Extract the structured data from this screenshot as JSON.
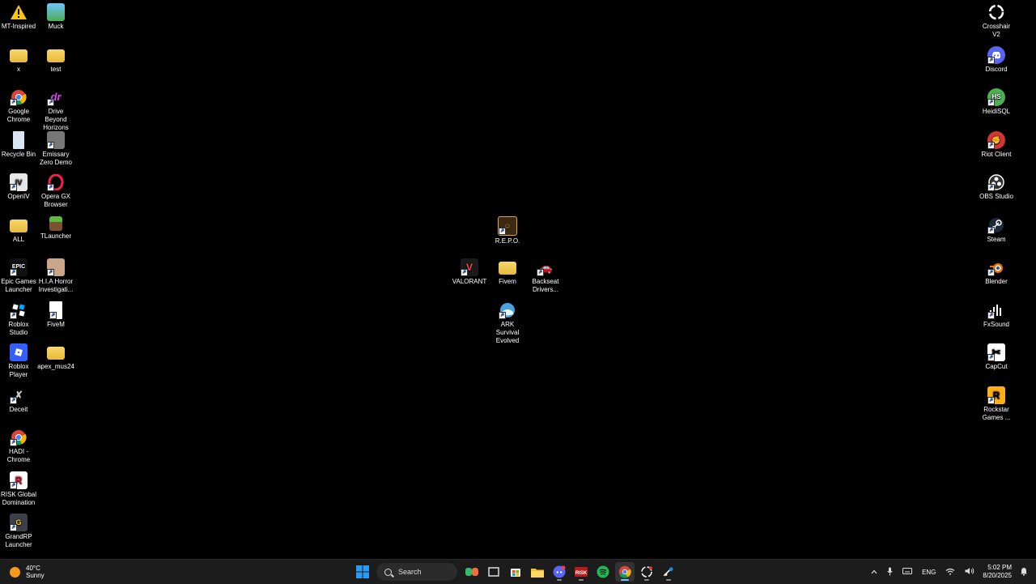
{
  "desktop_icons": [
    {
      "label": "MT-Inspired",
      "icon": "warning-icon"
    },
    {
      "label": "Muck",
      "icon": "muck-icon"
    },
    {
      "label": "x",
      "icon": "folder-icon"
    },
    {
      "label": "test",
      "icon": "folder-icon"
    },
    {
      "label": "Google Chrome",
      "icon": "chrome-icon"
    },
    {
      "label": "Drive Beyond Horizons D...",
      "icon": "drive-beyond-horizons-icon"
    },
    {
      "label": "Recycle Bin",
      "icon": "recycle-bin-icon"
    },
    {
      "label": "Emissary Zero Demo",
      "icon": "emissary-zero-icon"
    },
    {
      "label": "OpenIV",
      "icon": "openiv-icon"
    },
    {
      "label": "Opera GX Browser",
      "icon": "opera-gx-icon"
    },
    {
      "label": "ALL",
      "icon": "folder-icon"
    },
    {
      "label": "TLauncher",
      "icon": "tlauncher-icon"
    },
    {
      "label": "Epic Games Launcher",
      "icon": "epic-games-icon"
    },
    {
      "label": "H.I.A Horror Investigati...",
      "icon": "hia-horror-icon"
    },
    {
      "label": "Roblox Studio",
      "icon": "roblox-studio-icon"
    },
    {
      "label": "FiveM",
      "icon": "document-icon"
    },
    {
      "label": "Roblox Player",
      "icon": "roblox-player-icon"
    },
    {
      "label": "apex_mus24",
      "icon": "folder-icon"
    },
    {
      "label": "Deceit",
      "icon": "deceit-icon"
    },
    {
      "label": "HADI - Chrome",
      "icon": "chrome-icon"
    },
    {
      "label": "RISK Global Domination",
      "icon": "risk-icon"
    },
    {
      "label": "GrandRP Launcher",
      "icon": "grandrp-icon"
    },
    {
      "label": "R.E.P.O.",
      "icon": "repo-icon"
    },
    {
      "label": "VALORANT",
      "icon": "valorant-icon"
    },
    {
      "label": "Fivem",
      "icon": "folder-icon"
    },
    {
      "label": "Backseat Drivers...",
      "icon": "backseat-drivers-icon"
    },
    {
      "label": "ARK Survival Evolved",
      "icon": "ark-icon"
    },
    {
      "label": "Crosshair V2",
      "icon": "crosshair-icon"
    },
    {
      "label": "Discord",
      "icon": "discord-icon"
    },
    {
      "label": "HeidiSQL",
      "icon": "heidisql-icon"
    },
    {
      "label": "Riot Client",
      "icon": "riot-client-icon"
    },
    {
      "label": "OBS Studio",
      "icon": "obs-icon"
    },
    {
      "label": "Steam",
      "icon": "steam-icon"
    },
    {
      "label": "Blender",
      "icon": "blender-icon"
    },
    {
      "label": "FxSound",
      "icon": "fxsound-icon"
    },
    {
      "label": "CapCut",
      "icon": "capcut-icon"
    },
    {
      "label": "Rockstar Games ...",
      "icon": "rockstar-icon"
    }
  ],
  "taskbar": {
    "weather_temp": "40°C",
    "weather_desc": "Sunny",
    "search_placeholder": "Search",
    "pinned": [
      "start-icon",
      "search-icon",
      "copilot-icon",
      "task-view-icon",
      "store-icon",
      "file-explorer-icon",
      "discord-icon",
      "risk-icon",
      "spotify-icon",
      "chrome-icon",
      "crosshair-icon",
      "steam-icon"
    ],
    "language": "ENG",
    "time": "5:02 PM",
    "date": "8/20/2025"
  },
  "colors": {
    "desktop_bg": "#000000",
    "taskbar_bg": "#1c1c1c",
    "folder": "#f0c850",
    "windows_blue": "#2b9af3"
  }
}
